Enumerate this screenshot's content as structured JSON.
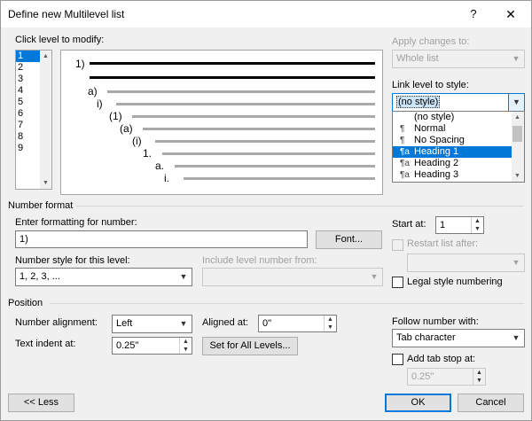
{
  "window": {
    "title": "Define new Multilevel list",
    "help": "?",
    "close": "✕"
  },
  "levels": {
    "label": "Click level to modify:",
    "items": [
      "1",
      "2",
      "3",
      "4",
      "5",
      "6",
      "7",
      "8",
      "9"
    ],
    "selected_index": 0
  },
  "preview": {
    "labels": [
      "1)",
      "a)",
      "i)",
      "(1)",
      "(a)",
      "(i)",
      "1.",
      "a.",
      "i."
    ]
  },
  "apply_changes": {
    "label": "Apply changes to:",
    "value": "Whole list"
  },
  "link_level": {
    "label": "Link level to style:",
    "value": "(no style)",
    "options": [
      {
        "mark": "",
        "text": "(no style)"
      },
      {
        "mark": "¶",
        "text": "Normal"
      },
      {
        "mark": "¶",
        "text": "No Spacing"
      },
      {
        "mark": "¶a",
        "text": "Heading 1"
      },
      {
        "mark": "¶a",
        "text": "Heading 2"
      },
      {
        "mark": "¶a",
        "text": "Heading 3"
      }
    ],
    "highlighted_index": 3
  },
  "number_format": {
    "section": "Number format",
    "enter_label": "Enter formatting for number:",
    "format_value": "1)",
    "font_button": "Font...",
    "style_label": "Number style for this level:",
    "style_value": "1, 2, 3, ...",
    "include_label": "Include level number from:",
    "include_value": "",
    "start_at_label": "Start at:",
    "start_at_value": "1",
    "restart_label": "Restart list after:",
    "restart_value": "",
    "legal_label": "Legal style numbering"
  },
  "position": {
    "section": "Position",
    "alignment_label": "Number alignment:",
    "alignment_value": "Left",
    "aligned_at_label": "Aligned at:",
    "aligned_at_value": "0\"",
    "indent_label": "Text indent at:",
    "indent_value": "0.25\"",
    "set_all_button": "Set for All Levels...",
    "follow_label": "Follow number with:",
    "follow_value": "Tab character",
    "add_tab_label": "Add tab stop at:",
    "add_tab_value": "0.25\""
  },
  "buttons": {
    "less": "<< Less",
    "ok": "OK",
    "cancel": "Cancel"
  }
}
